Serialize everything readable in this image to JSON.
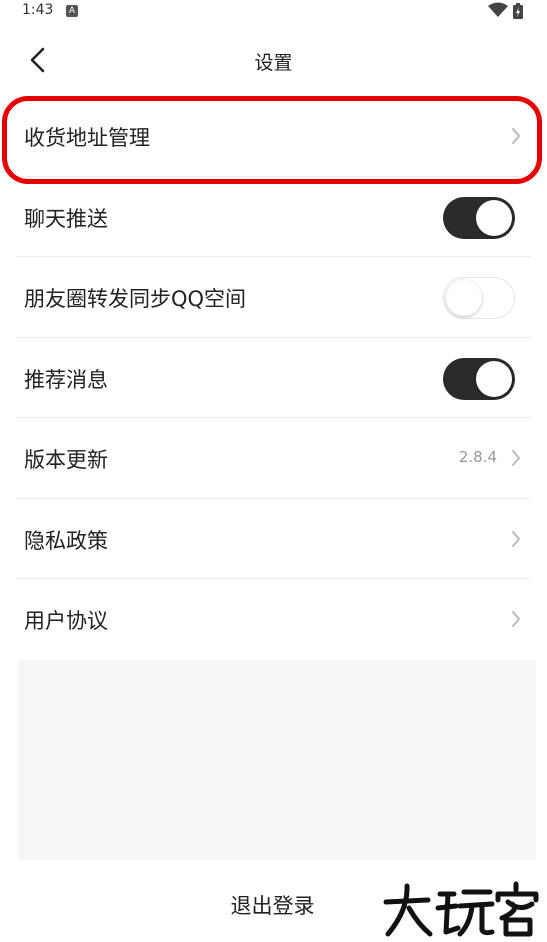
{
  "status_bar": {
    "time": "1:43",
    "notification_badge": "A"
  },
  "nav": {
    "title": "设置"
  },
  "settings": [
    {
      "label": "收货地址管理",
      "type": "link"
    },
    {
      "label": "聊天推送",
      "type": "toggle",
      "checked": true
    },
    {
      "label": "朋友圈转发同步QQ空间",
      "type": "toggle",
      "checked": false
    },
    {
      "label": "推荐消息",
      "type": "toggle",
      "checked": true
    },
    {
      "label": "版本更新",
      "type": "link",
      "value": "2.8.4"
    },
    {
      "label": "隐私政策",
      "type": "link"
    },
    {
      "label": "用户协议",
      "type": "link"
    }
  ],
  "logout_label": "退出登录",
  "watermark": "大玩客",
  "colors": {
    "toggle_on": "#2b2b2b",
    "highlight": "#e60000",
    "panel": "#f6f6f6"
  }
}
